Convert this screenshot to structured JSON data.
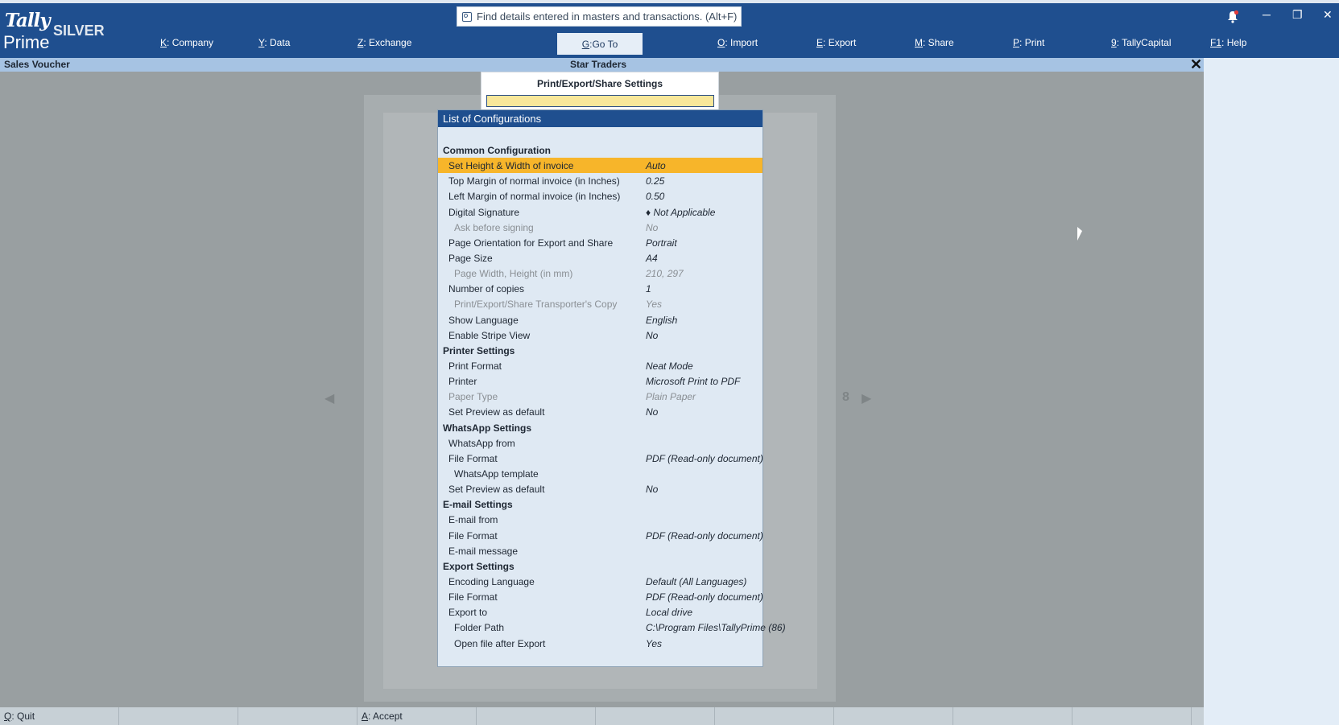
{
  "app": {
    "logo_top": "Tally",
    "logo_bottom": "Prime",
    "edition": "SILVER"
  },
  "search": {
    "placeholder": "Find details entered in masters and transactions. (Alt+F)"
  },
  "menu": [
    {
      "key": "K",
      "label": "Company"
    },
    {
      "key": "Y",
      "label": "Data"
    },
    {
      "key": "Z",
      "label": "Exchange"
    },
    {
      "key": "G",
      "label": "Go To"
    },
    {
      "key": "O",
      "label": "Import"
    },
    {
      "key": "E",
      "label": "Export"
    },
    {
      "key": "M",
      "label": "Share"
    },
    {
      "key": "P",
      "label": "Print"
    },
    {
      "key": "9",
      "label": "TallyCapital"
    },
    {
      "key": "F1",
      "label": "Help"
    }
  ],
  "titlebar": {
    "screen": "Sales Voucher",
    "company": "Star Traders",
    "close": "✕"
  },
  "dialog": {
    "title": "Print/Export/Share Settings",
    "input_value": ""
  },
  "config_list": {
    "title": "List of Configurations",
    "rows": [
      {
        "type": "section",
        "label": "Common Configuration",
        "value": ""
      },
      {
        "type": "l1",
        "label": "Set Height & Width of invoice",
        "value": "Auto",
        "selected": true
      },
      {
        "type": "l1",
        "label": "Top Margin of normal invoice (in Inches)",
        "value": "0.25"
      },
      {
        "type": "l1",
        "label": "Left Margin of normal invoice (in Inches)",
        "value": "0.50"
      },
      {
        "type": "l1",
        "label": "Digital Signature",
        "value": "♦ Not Applicable"
      },
      {
        "type": "l2",
        "label": "Ask before signing",
        "value": "No",
        "dim": true
      },
      {
        "type": "l1",
        "label": "Page Orientation for Export and Share",
        "value": "Portrait"
      },
      {
        "type": "l1",
        "label": "Page Size",
        "value": "A4"
      },
      {
        "type": "l2",
        "label": "Page Width, Height (in mm)",
        "value": "210, 297",
        "dim": true
      },
      {
        "type": "l1",
        "label": "Number of copies",
        "value": "1"
      },
      {
        "type": "l2",
        "label": "Print/Export/Share Transporter's Copy",
        "value": "Yes",
        "dim": true
      },
      {
        "type": "l1",
        "label": "Show Language",
        "value": "English"
      },
      {
        "type": "l1",
        "label": "Enable Stripe View",
        "value": "No"
      },
      {
        "type": "section",
        "label": "Printer Settings",
        "value": ""
      },
      {
        "type": "l1",
        "label": "Print Format",
        "value": "Neat Mode"
      },
      {
        "type": "l1",
        "label": "Printer",
        "value": "Microsoft Print to PDF"
      },
      {
        "type": "l1",
        "label": "Paper Type",
        "value": "Plain Paper",
        "dim": true
      },
      {
        "type": "l1",
        "label": "Set Preview as default",
        "value": "No"
      },
      {
        "type": "section",
        "label": "WhatsApp Settings",
        "value": ""
      },
      {
        "type": "l1",
        "label": "WhatsApp from",
        "value": ""
      },
      {
        "type": "l1",
        "label": "File Format",
        "value": "PDF (Read-only document)"
      },
      {
        "type": "l2",
        "label": "WhatsApp template",
        "value": ""
      },
      {
        "type": "l1",
        "label": "Set Preview as default",
        "value": "No"
      },
      {
        "type": "section",
        "label": "E-mail Settings",
        "value": ""
      },
      {
        "type": "l1",
        "label": "E-mail from",
        "value": ""
      },
      {
        "type": "l1",
        "label": "File Format",
        "value": "PDF (Read-only document)"
      },
      {
        "type": "l1",
        "label": "E-mail message",
        "value": ""
      },
      {
        "type": "section",
        "label": "Export Settings",
        "value": ""
      },
      {
        "type": "l1",
        "label": "Encoding Language",
        "value": "Default (All Languages)"
      },
      {
        "type": "l1",
        "label": "File Format",
        "value": "PDF (Read-only document)"
      },
      {
        "type": "l1",
        "label": "Export to",
        "value": "Local drive"
      },
      {
        "type": "l2",
        "label": "Folder Path",
        "value": "C:\\Program Files\\TallyPrime (86)"
      },
      {
        "type": "l2",
        "label": "Open file after Export",
        "value": "Yes"
      }
    ]
  },
  "footer": [
    {
      "key": "Q",
      "label": "Quit"
    },
    {
      "key": "",
      "label": ""
    },
    {
      "key": "",
      "label": ""
    },
    {
      "key": "A",
      "label": "Accept"
    },
    {
      "key": "",
      "label": ""
    },
    {
      "key": "",
      "label": ""
    },
    {
      "key": "",
      "label": ""
    },
    {
      "key": "",
      "label": ""
    },
    {
      "key": "",
      "label": ""
    },
    {
      "key": "",
      "label": ""
    }
  ],
  "preview": {
    "page_number": "8"
  },
  "colors": {
    "header": "#1f4f8f",
    "selected": "#f7b52a",
    "list_bg": "#dfe9f3"
  }
}
